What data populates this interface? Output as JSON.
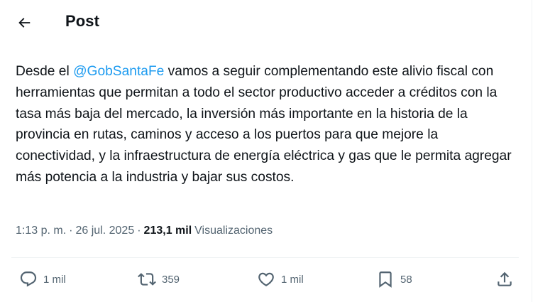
{
  "header": {
    "title": "Post",
    "back_icon": "arrow-left-icon"
  },
  "post": {
    "text_before": "Desde el ",
    "mention": "@GobSantaFe",
    "text_after": " vamos a seguir complementando este alivio fiscal con herramientas que permitan a todo el sector productivo acceder a créditos con la tasa más baja del mercado, la inversión más importante en la historia de la provincia en rutas, caminos y acceso a los puertos para que mejore la conectividad, y la infraestructura de energía eléctrica y gas que le permita agregar más potencia a la industria y bajar sus costos."
  },
  "meta": {
    "time": "1:13 p. m.",
    "separator": "·",
    "date": "26 jul. 2025",
    "views_count": "213,1 mil",
    "views_label": "Visualizaciones"
  },
  "actions": {
    "replies": "1 mil",
    "reposts": "359",
    "likes": "1 mil",
    "bookmarks": "58"
  },
  "colors": {
    "text": "#0f1419",
    "secondary": "#536471",
    "accent": "#1d9bf0",
    "divider": "#eff3f4"
  }
}
